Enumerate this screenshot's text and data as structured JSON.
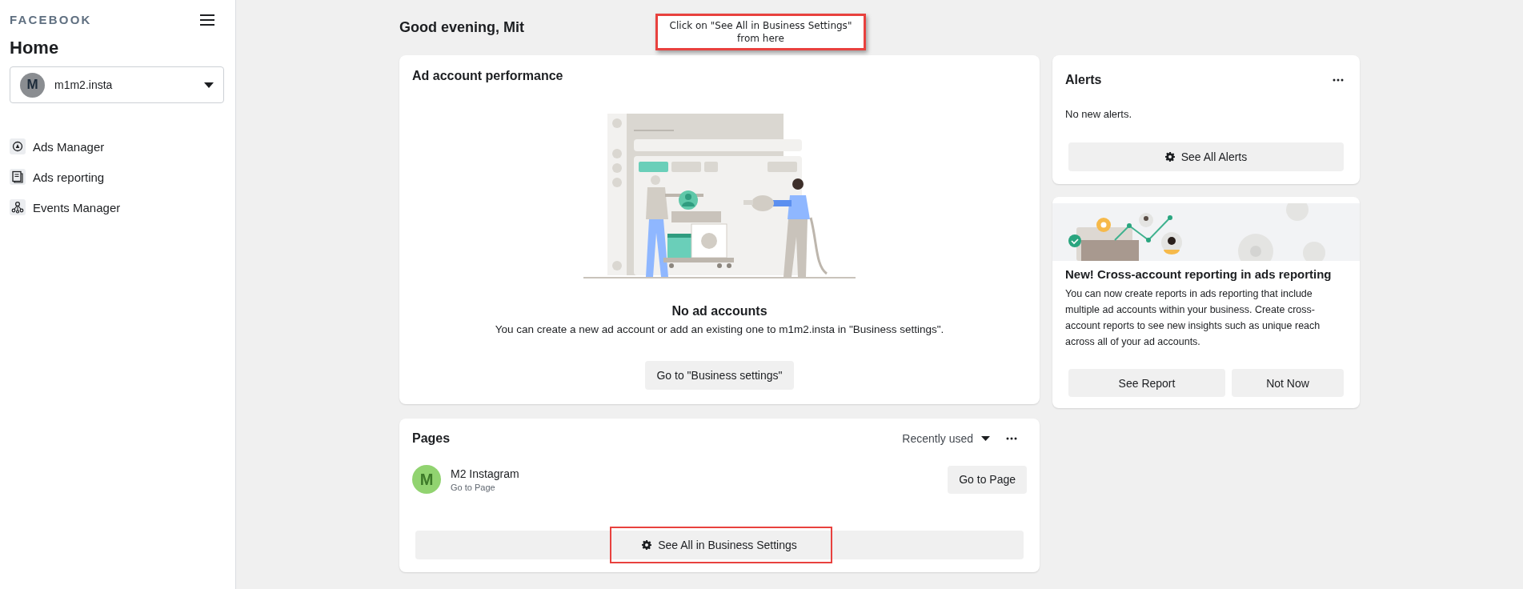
{
  "sidebar": {
    "logo": "FACEBOOK",
    "title": "Home",
    "account": {
      "initial": "M",
      "name": "m1m2.insta"
    },
    "nav": [
      {
        "label": "Ads Manager",
        "kind": "compass"
      },
      {
        "label": "Ads reporting",
        "kind": "report"
      },
      {
        "label": "Events Manager",
        "kind": "network"
      }
    ]
  },
  "greeting": "Good evening, Mit",
  "callout": "Click on \"See All in Business Settings\" from here",
  "ad_performance": {
    "title": "Ad account performance",
    "empty_title": "No ad accounts",
    "empty_text": "You can create a new ad account or add an existing one to m1m2.insta in \"Business settings\".",
    "button": "Go to \"Business settings\""
  },
  "pages": {
    "title": "Pages",
    "sort": "Recently used",
    "items": [
      {
        "initial": "M",
        "name": "M2 Instagram",
        "link": "Go to Page",
        "button": "Go to Page"
      }
    ],
    "see_all": "See All in Business Settings",
    "see_all_highlighted": true
  },
  "alerts": {
    "title": "Alerts",
    "empty_text": "No new alerts.",
    "button": "See All Alerts"
  },
  "promo": {
    "title": "New! Cross-account reporting in ads reporting",
    "text": "You can now create reports in ads reporting that include multiple ad accounts within your business. Create cross-account reports to see new insights such as unique reach across all of your ad accounts.",
    "buttons": [
      "See Report",
      "Not Now"
    ]
  }
}
